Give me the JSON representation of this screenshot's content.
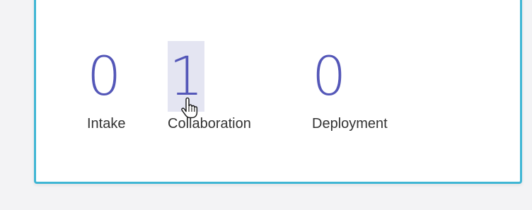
{
  "stats": [
    {
      "value": "0",
      "label": "Intake"
    },
    {
      "value": "1",
      "label": "Collaboration"
    },
    {
      "value": "0",
      "label": "Deployment"
    }
  ],
  "colors": {
    "number": "#5457b8",
    "border_accent": "#40b6d4",
    "highlight": "#e4e5f2",
    "label": "#333333"
  },
  "cursor": {
    "icon": "hand-pointer-icon"
  }
}
